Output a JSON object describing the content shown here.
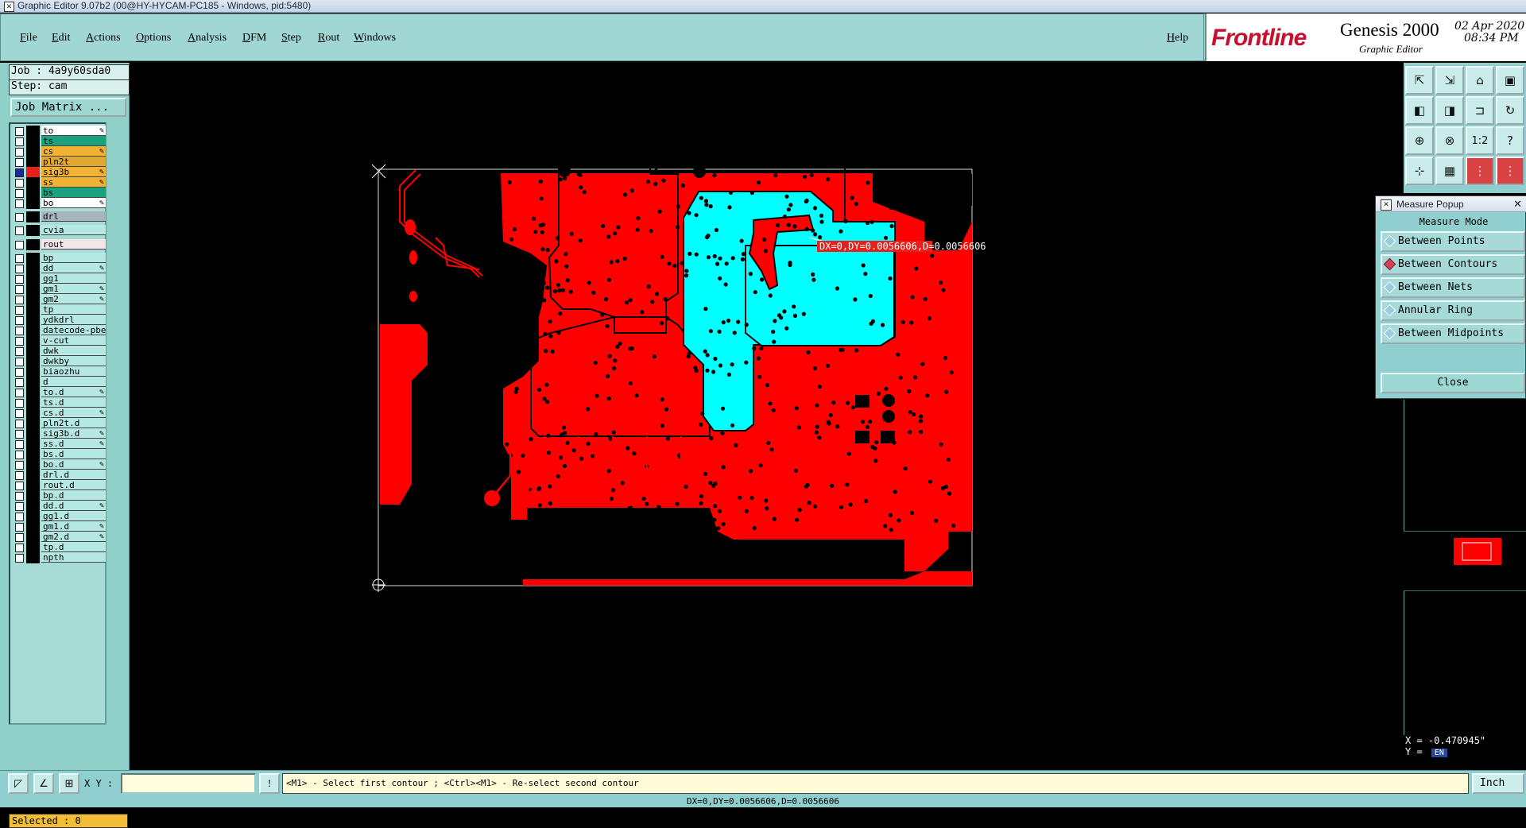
{
  "window": {
    "title": "Graphic Editor 9.07b2 (00@HY-HYCAM-PC185 - Windows, pid:5480)"
  },
  "menu": {
    "items": [
      "File",
      "Edit",
      "Actions",
      "Options",
      "Analysis",
      "DFM",
      "Step",
      "Rout",
      "Windows"
    ],
    "help": "Help"
  },
  "brand": {
    "logo": "Frontline",
    "product": "Genesis 2000",
    "subtitle": "Graphic Editor",
    "date": "02 Apr 2020",
    "time": "08:34 PM"
  },
  "job": {
    "job_label": "Job : 4a9y60sda0",
    "step_label": "Step: cam",
    "matrix_button": "Job Matrix ..."
  },
  "layers": [
    {
      "name": "to",
      "color": "#ffffff",
      "pen": true
    },
    {
      "name": "ts",
      "color": "#1aa27e",
      "pen": false
    },
    {
      "name": "cs",
      "color": "#f2b233",
      "pen": true
    },
    {
      "name": "pln2t",
      "color": "#e0a830",
      "pen": false
    },
    {
      "name": "sig3b",
      "color": "#f2b233",
      "pen": true,
      "active": true,
      "swatch": "#e8201b"
    },
    {
      "name": "ss",
      "color": "#f2b233",
      "pen": true
    },
    {
      "name": "bs",
      "color": "#1aa27e",
      "pen": false
    },
    {
      "name": "bo",
      "color": "#ffffff",
      "pen": true
    },
    {
      "name": "drl",
      "color": "#a8b4bc",
      "pen": false
    },
    {
      "name": "cvia",
      "color": "#b6e8e4",
      "pen": false
    },
    {
      "name": "rout",
      "color": "#f4e6e6",
      "pen": false
    },
    {
      "name": "bp",
      "color": "#b6e8e4",
      "pen": false
    },
    {
      "name": "dd",
      "color": "#b6e8e4",
      "pen": true
    },
    {
      "name": "gg1",
      "color": "#b6e8e4",
      "pen": false
    },
    {
      "name": "gm1",
      "color": "#b6e8e4",
      "pen": true
    },
    {
      "name": "gm2",
      "color": "#b6e8e4",
      "pen": true
    },
    {
      "name": "tp",
      "color": "#b6e8e4",
      "pen": false
    },
    {
      "name": "ydkdrl",
      "color": "#b6e8e4",
      "pen": false
    },
    {
      "name": "datecode-pbe",
      "color": "#b6e8e4",
      "pen": false
    },
    {
      "name": "v-cut",
      "color": "#b6e8e4",
      "pen": false
    },
    {
      "name": "dwk",
      "color": "#b6e8e4",
      "pen": false
    },
    {
      "name": "dwkby",
      "color": "#b6e8e4",
      "pen": false
    },
    {
      "name": "biaozhu",
      "color": "#b6e8e4",
      "pen": false
    },
    {
      "name": "d",
      "color": "#b6e8e4",
      "pen": false
    },
    {
      "name": "to.d",
      "color": "#b6e8e4",
      "pen": true
    },
    {
      "name": "ts.d",
      "color": "#b6e8e4",
      "pen": false
    },
    {
      "name": "cs.d",
      "color": "#b6e8e4",
      "pen": true
    },
    {
      "name": "pln2t.d",
      "color": "#b6e8e4",
      "pen": false
    },
    {
      "name": "sig3b.d",
      "color": "#b6e8e4",
      "pen": true
    },
    {
      "name": "ss.d",
      "color": "#b6e8e4",
      "pen": true
    },
    {
      "name": "bs.d",
      "color": "#b6e8e4",
      "pen": false
    },
    {
      "name": "bo.d",
      "color": "#b6e8e4",
      "pen": true
    },
    {
      "name": "drl.d",
      "color": "#b6e8e4",
      "pen": false
    },
    {
      "name": "rout.d",
      "color": "#b6e8e4",
      "pen": false
    },
    {
      "name": "bp.d",
      "color": "#b6e8e4",
      "pen": false
    },
    {
      "name": "dd.d",
      "color": "#b6e8e4",
      "pen": true
    },
    {
      "name": "gg1.d",
      "color": "#b6e8e4",
      "pen": false
    },
    {
      "name": "gm1.d",
      "color": "#b6e8e4",
      "pen": true
    },
    {
      "name": "gm2.d",
      "color": "#b6e8e4",
      "pen": true
    },
    {
      "name": "tp.d",
      "color": "#b6e8e4",
      "pen": false
    },
    {
      "name": "npth",
      "color": "#b6e8e4",
      "pen": false
    }
  ],
  "selected_label": "Selected : 0",
  "canvas": {
    "measure_label": "DX=0,DY=0.0056606,D=0.0056606"
  },
  "measure_popup": {
    "title": "Measure Popup",
    "mode_label": "Measure Mode",
    "options": [
      "Between Points",
      "Between Contours",
      "Between Nets",
      "Annular Ring",
      "Between Midpoints"
    ],
    "selected": "Between Contours",
    "close": "Close"
  },
  "coords": {
    "x": "X = -0.470945\"",
    "y": "Y = ",
    "ime": "EN"
  },
  "bottom": {
    "xy_label": "X Y :",
    "xy_value": "",
    "prompt": "<M1> - Select first contour ; <Ctrl><M1> - Re-select second contour",
    "units": "Inch"
  },
  "status": "DX=0,DY=0.0056606,D=0.0056606"
}
